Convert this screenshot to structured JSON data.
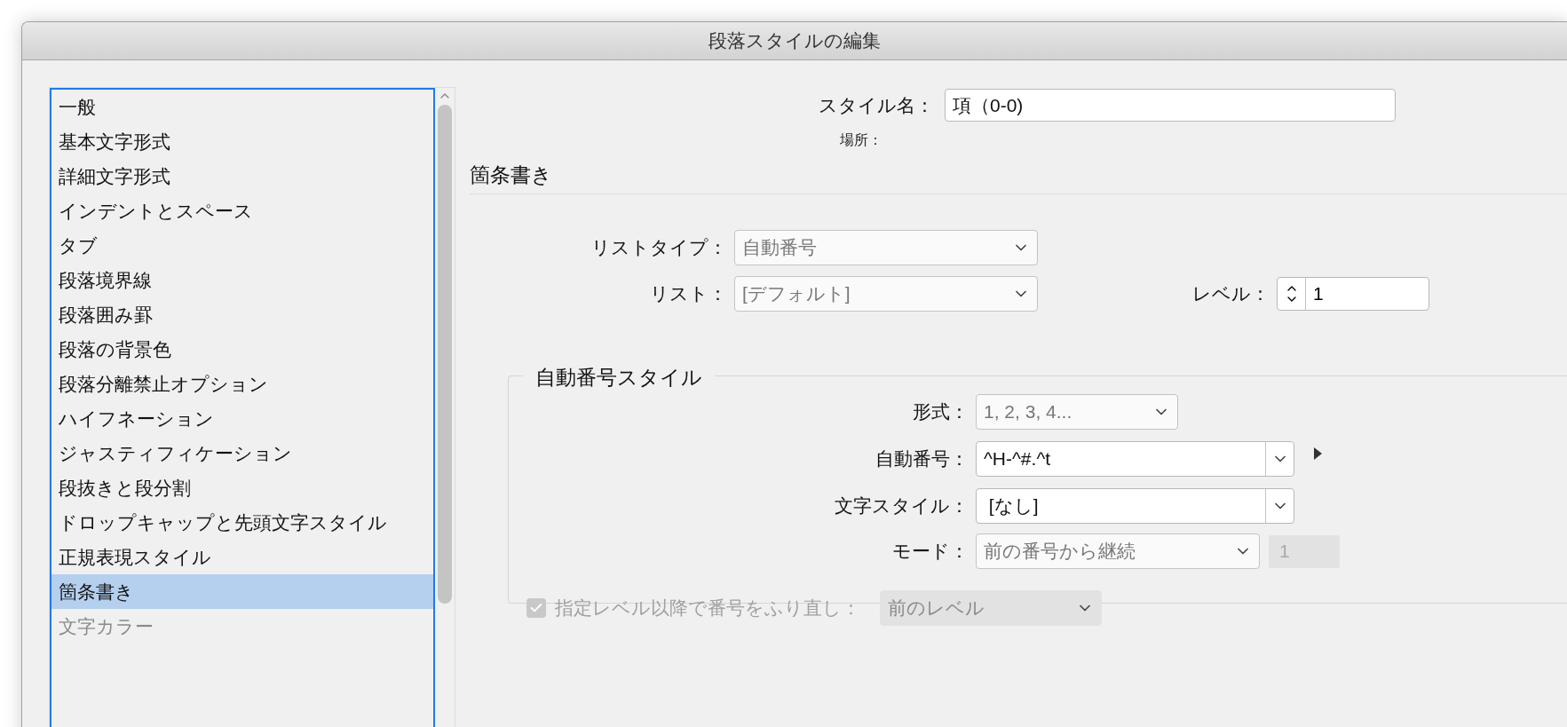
{
  "window": {
    "title": "段落スタイルの編集"
  },
  "sidebar": {
    "items": [
      {
        "label": "一般",
        "selected": false,
        "disabled": false
      },
      {
        "label": "基本文字形式",
        "selected": false,
        "disabled": false
      },
      {
        "label": "詳細文字形式",
        "selected": false,
        "disabled": false
      },
      {
        "label": "インデントとスペース",
        "selected": false,
        "disabled": false
      },
      {
        "label": "タブ",
        "selected": false,
        "disabled": false
      },
      {
        "label": "段落境界線",
        "selected": false,
        "disabled": false
      },
      {
        "label": "段落囲み罫",
        "selected": false,
        "disabled": false
      },
      {
        "label": "段落の背景色",
        "selected": false,
        "disabled": false
      },
      {
        "label": "段落分離禁止オプション",
        "selected": false,
        "disabled": false
      },
      {
        "label": "ハイフネーション",
        "selected": false,
        "disabled": false
      },
      {
        "label": "ジャスティフィケーション",
        "selected": false,
        "disabled": false
      },
      {
        "label": "段抜きと段分割",
        "selected": false,
        "disabled": false
      },
      {
        "label": "ドロップキャップと先頭文字スタイル",
        "selected": false,
        "disabled": false
      },
      {
        "label": "正規表現スタイル",
        "selected": false,
        "disabled": false
      },
      {
        "label": "箇条書き",
        "selected": true,
        "disabled": false
      },
      {
        "label": "文字カラー",
        "selected": false,
        "disabled": true
      }
    ]
  },
  "style_name": {
    "label": "スタイル名：",
    "value": "項（0-0)"
  },
  "location": {
    "label": "場所："
  },
  "section_title": "箇条書き",
  "list_type": {
    "label": "リストタイプ：",
    "value": "自動番号"
  },
  "list": {
    "label": "リスト：",
    "value": "[デフォルト]"
  },
  "level": {
    "label": "レベル：",
    "value": "1"
  },
  "numbering_style": {
    "title": "自動番号スタイル",
    "format": {
      "label": "形式：",
      "value": "1, 2, 3, 4..."
    },
    "number": {
      "label": "自動番号：",
      "value": "^H-^#.^t"
    },
    "char_style": {
      "label": "文字スタイル：",
      "value": " [なし]"
    },
    "mode": {
      "label": "モード：",
      "value": "前の番号から継続",
      "start_value": "1",
      "start_disabled": true
    },
    "restart": {
      "label": "指定レベル以降で番号をふり直し：",
      "checked": true,
      "disabled": true,
      "value": "前のレベル"
    }
  }
}
